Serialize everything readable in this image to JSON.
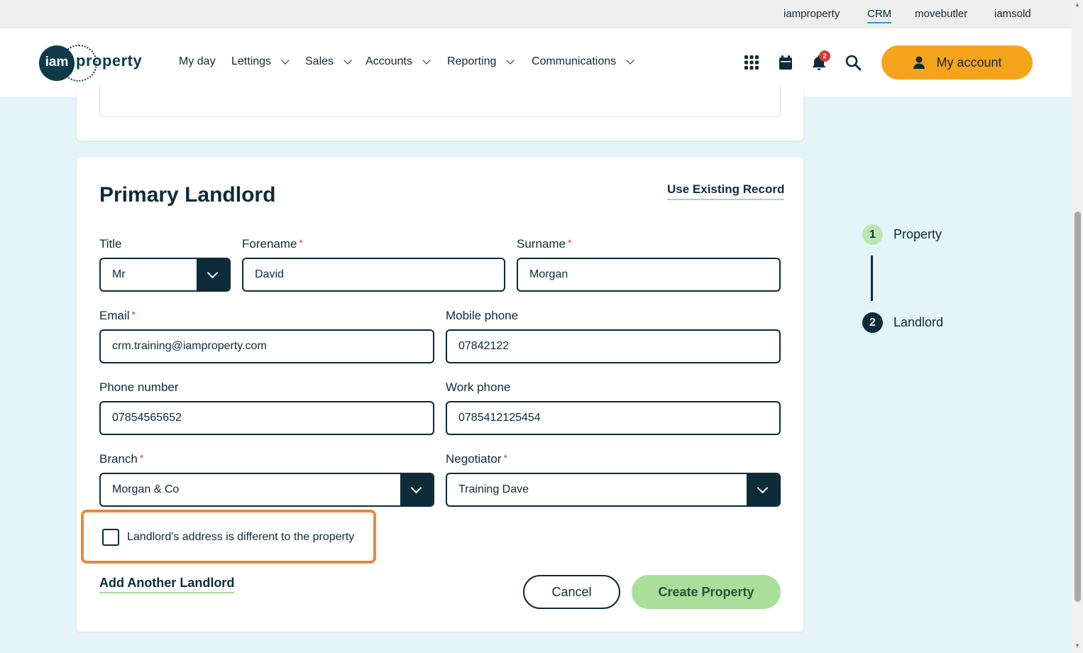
{
  "top_links": [
    {
      "label": "iamproperty"
    },
    {
      "label": "CRM"
    },
    {
      "label": "movebutler"
    },
    {
      "label": "iamsold"
    }
  ],
  "logo": {
    "circle_text": "iam",
    "text": "property"
  },
  "nav": [
    {
      "label": "My day"
    },
    {
      "label": "Lettings"
    },
    {
      "label": "Sales"
    },
    {
      "label": "Accounts"
    },
    {
      "label": "Reporting"
    },
    {
      "label": "Communications"
    }
  ],
  "header_icons": {
    "apps": "grid-icon",
    "calendar": "calendar-icon",
    "notifications": "bell-icon",
    "notification_count": "2",
    "search": "search-icon"
  },
  "account_button": {
    "label": "My account",
    "icon": "user-icon"
  },
  "form": {
    "title": "Primary Landlord",
    "use_existing": "Use Existing Record",
    "title_label": "Title",
    "title_value": "Mr",
    "forename_label": "Forename",
    "forename_value": "David",
    "surname_label": "Surname",
    "surname_value": "Morgan",
    "email_label": "Email",
    "email_value": "crm.training@iamproperty.com",
    "mobile_label": "Mobile phone",
    "mobile_value": "07842122",
    "phone_label": "Phone number",
    "phone_value": "07854565652",
    "work_label": "Work phone",
    "work_value": "0785412125454",
    "branch_label": "Branch",
    "branch_value": "Morgan & Co",
    "negotiator_label": "Negotiator",
    "negotiator_value": "Training Dave",
    "required_mark": "*",
    "checkbox_label": "Landlord's address is different to the property",
    "checkbox_checked": false,
    "add_another": "Add Another Landlord",
    "cancel": "Cancel",
    "create": "Create Property"
  },
  "steps": [
    {
      "number": "1",
      "label": "Property"
    },
    {
      "number": "2",
      "label": "Landlord"
    }
  ],
  "colors": {
    "primary": "#0d2b38",
    "accent_orange": "#f7a41d",
    "success_green": "#a9df9b",
    "page_bg": "#e4f4f9",
    "highlight": "#e8893a"
  }
}
